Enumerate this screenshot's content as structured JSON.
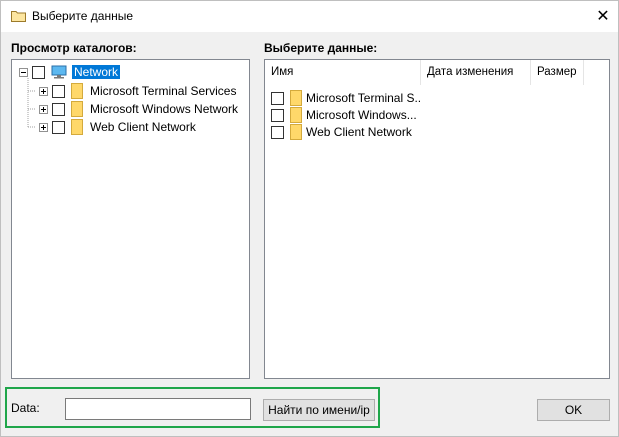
{
  "window": {
    "title": "Выберите данные",
    "title_icon": "folder-icon",
    "close_symbol": "✕"
  },
  "catalog_panel": {
    "label": "Просмотр каталогов:",
    "tree": {
      "root": {
        "label": "Network",
        "icon": "network-computer-icon",
        "checked": false,
        "expanded": true,
        "selected": true
      },
      "children": [
        {
          "label": "Microsoft Terminal Services",
          "icon": "folder-icon",
          "checked": false,
          "expanded": false
        },
        {
          "label": "Microsoft Windows Network",
          "icon": "folder-icon",
          "checked": false,
          "expanded": false
        },
        {
          "label": "Web Client Network",
          "icon": "folder-icon",
          "checked": false,
          "expanded": false
        }
      ]
    }
  },
  "data_panel": {
    "label": "Выберите данные:",
    "columns": [
      "Имя",
      "Дата изменения",
      "Размер"
    ],
    "rows": [
      {
        "name": "Microsoft Terminal S...",
        "checked": false
      },
      {
        "name": "Microsoft Windows...",
        "checked": false
      },
      {
        "name": "Web Client Network",
        "checked": false
      }
    ]
  },
  "bottom": {
    "data_label": "Data:",
    "data_value": "",
    "find_button": "Найти по имени/ip",
    "ok_button": "OK",
    "highlight_color": "#1fa64a"
  },
  "colors": {
    "selection": "#0078d7",
    "folder": "#ffd86a"
  }
}
